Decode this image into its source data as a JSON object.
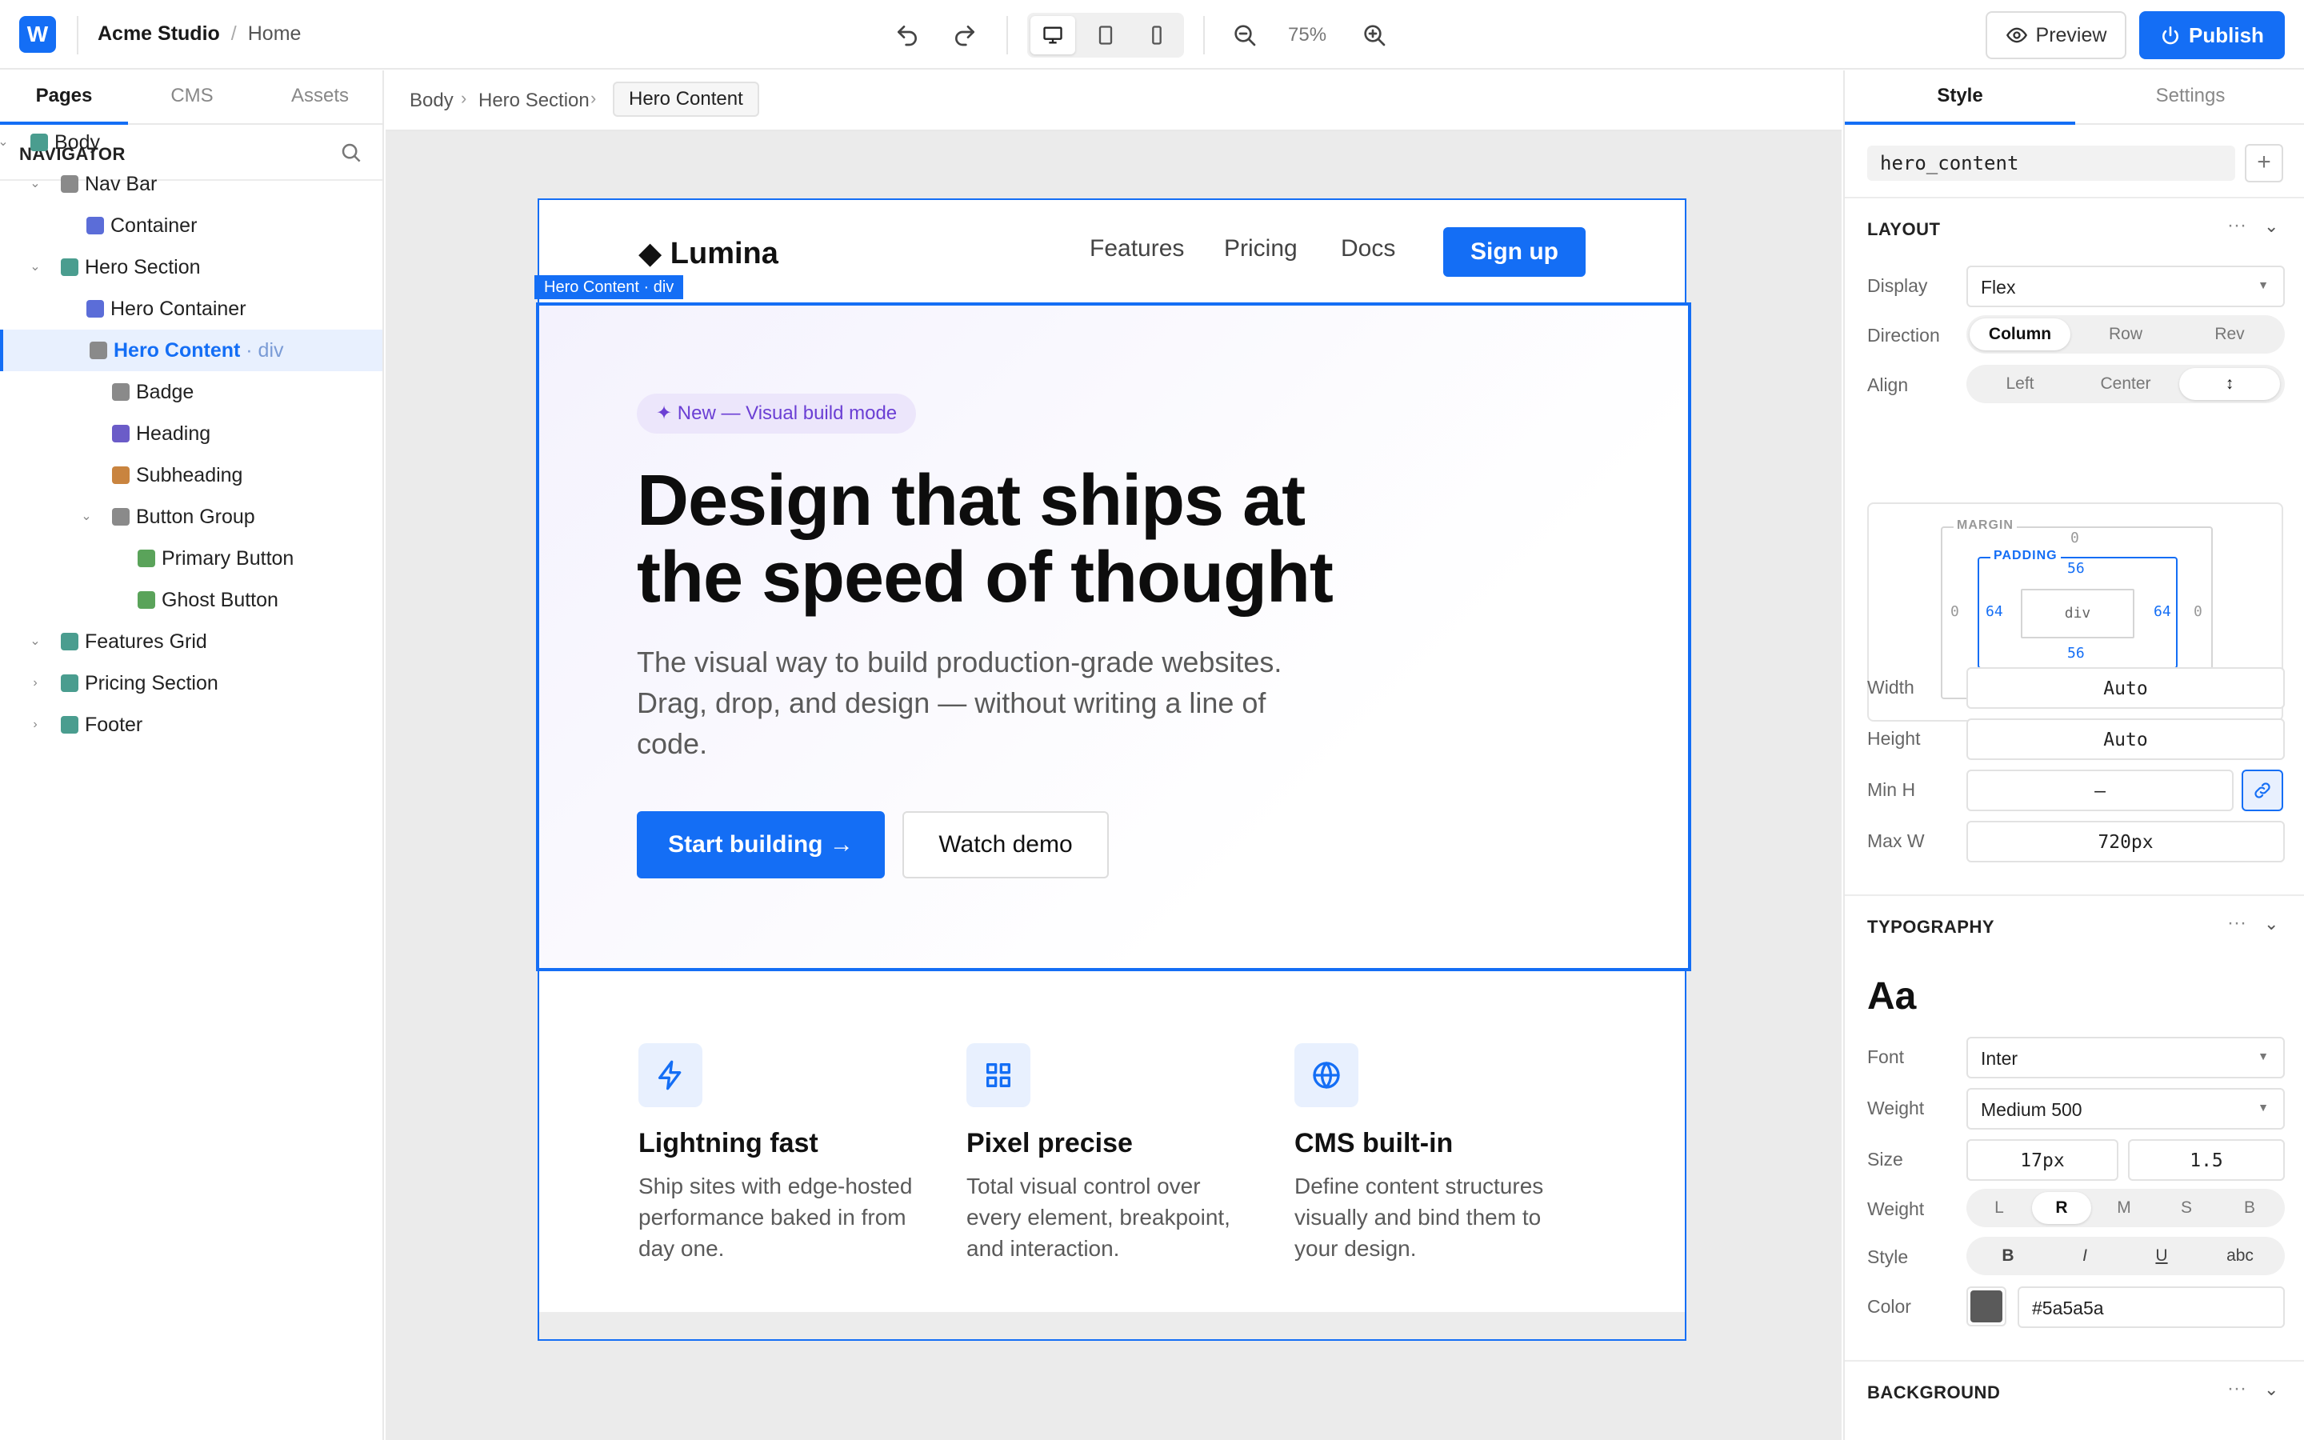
{
  "app": {
    "logo": "W",
    "project": "Acme Studio",
    "sep": "/",
    "page": "Home"
  },
  "toolbar": {
    "zoom": "75%",
    "preview": "Preview",
    "publish": "Publish"
  },
  "left": {
    "tabs": [
      "Pages",
      "CMS",
      "Assets"
    ],
    "navigator_title": "NAVIGATOR",
    "tree": [
      {
        "label": "Body",
        "color": "#4a9d8f",
        "depth": 0,
        "chev": "down"
      },
      {
        "label": "Nav Bar",
        "color": "#8a8a8a",
        "depth": 1,
        "chev": "down"
      },
      {
        "label": "Container",
        "color": "#5b6dd8",
        "depth": 2,
        "chev": ""
      },
      {
        "label": "Hero Section",
        "color": "#4a9d8f",
        "depth": 1,
        "chev": "down"
      },
      {
        "label": "Hero Container",
        "color": "#5b6dd8",
        "depth": 2,
        "chev": ""
      },
      {
        "label": "Hero Content",
        "tag": "· div",
        "color": "#8a8a8a",
        "depth": 2,
        "chev": "",
        "selected": true
      },
      {
        "label": "Badge",
        "color": "#8a8a8a",
        "depth": 3,
        "chev": ""
      },
      {
        "label": "Heading",
        "color": "#6b5cc8",
        "depth": 3,
        "chev": ""
      },
      {
        "label": "Subheading",
        "color": "#c9843f",
        "depth": 3,
        "chev": ""
      },
      {
        "label": "Button Group",
        "color": "#8a8a8a",
        "depth": 3,
        "chev": "down"
      },
      {
        "label": "Primary Button",
        "color": "#5aa35a",
        "depth": 4,
        "chev": ""
      },
      {
        "label": "Ghost Button",
        "color": "#5aa35a",
        "depth": 4,
        "chev": ""
      },
      {
        "label": "Features Grid",
        "color": "#4a9d8f",
        "depth": 1,
        "chev": "down"
      },
      {
        "label": "Pricing Section",
        "color": "#4a9d8f",
        "depth": 1,
        "chev": "right"
      },
      {
        "label": "Footer",
        "color": "#4a9d8f",
        "depth": 1,
        "chev": "right"
      }
    ]
  },
  "canvas": {
    "breadcrumbs": [
      "Body",
      "Hero Section",
      "Hero Content"
    ],
    "selection_label": "Hero Content · div",
    "site": {
      "brand": "◆ Lumina",
      "nav": [
        "Features",
        "Pricing",
        "Docs"
      ],
      "signup": "Sign up",
      "badge": "✦ New — Visual build mode",
      "heading": "Design that ships at the speed of thought",
      "sub": "The visual way to build production-grade websites. Drag, drop, and design — without writing a line of code.",
      "cta_primary": "Start building →",
      "cta_secondary": "Watch demo",
      "features": [
        {
          "icon": "bolt-icon",
          "title": "Lightning fast",
          "desc": "Ship sites with edge-hosted performance baked in from day one."
        },
        {
          "icon": "grid-icon",
          "title": "Pixel precise",
          "desc": "Total visual control over every element, breakpoint, and interaction."
        },
        {
          "icon": "globe-icon",
          "title": "CMS built-in",
          "desc": "Define content structures visually and bind them to your design."
        }
      ]
    }
  },
  "right": {
    "tabs": [
      "Style",
      "Settings"
    ],
    "class_name": "hero_content",
    "add": "+",
    "layout": {
      "title": "LAYOUT",
      "display_label": "Display",
      "display": "Flex",
      "direction_label": "Direction",
      "direction_options": [
        "Column",
        "Row",
        "Rev"
      ],
      "align_label": "Align",
      "align_options": [
        "Left",
        "Center",
        "↕"
      ],
      "box": {
        "margin_label": "MARGIN",
        "padding_label": "PADDING",
        "margin": [
          "0",
          "0",
          "0",
          "0"
        ],
        "padding": [
          "56",
          "64",
          "56",
          "64"
        ],
        "content": "div"
      },
      "width_label": "Width",
      "width": "Auto",
      "height_label": "Height",
      "height": "Auto",
      "minh_label": "Min H",
      "minh": "–",
      "maxw_label": "Max W",
      "maxw": "720px"
    },
    "typography": {
      "title": "TYPOGRAPHY",
      "preview": "Aa",
      "font_label": "Font",
      "font": "Inter",
      "weight_label": "Weight",
      "weight": "Medium 500",
      "size_label": "Size",
      "size": "17px",
      "line_height": "1.5",
      "weight2_label": "Weight",
      "weight_options": [
        "L",
        "R",
        "M",
        "S",
        "B"
      ],
      "style_label": "Style",
      "style_options": [
        "B",
        "I",
        "U",
        "abc"
      ],
      "color_label": "Color",
      "color": "#5a5a5a"
    },
    "background": {
      "title": "BACKGROUND"
    },
    "section_dots": "···"
  }
}
